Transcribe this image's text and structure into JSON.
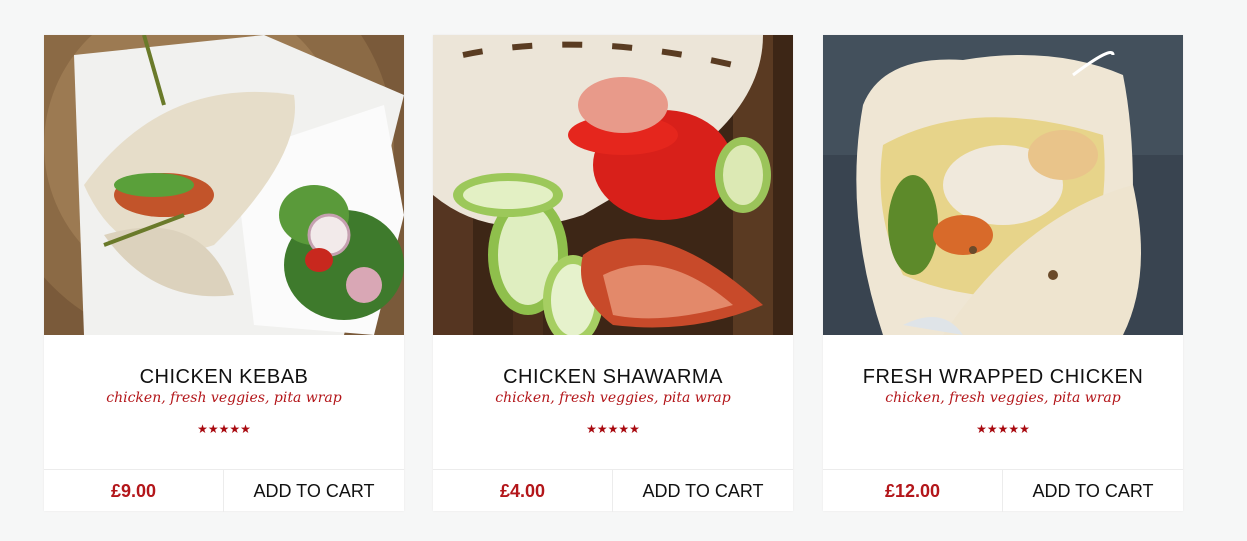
{
  "products": [
    {
      "title": "CHICKEN KEBAB",
      "description": "chicken, fresh veggies, pita wrap",
      "rating": 5,
      "rating_display": "★★★★★",
      "price": "£9.00",
      "cart_label": "ADD TO CART",
      "image_alt": "chicken-kebab-photo"
    },
    {
      "title": "CHICKEN SHAWARMA",
      "description": "chicken, fresh veggies, pita wrap",
      "rating": 5,
      "rating_display": "★★★★★",
      "price": "£4.00",
      "cart_label": "ADD TO CART",
      "image_alt": "chicken-shawarma-photo"
    },
    {
      "title": "FRESH WRAPPED CHICKEN",
      "description": "chicken, fresh veggies, pita wrap",
      "rating": 5,
      "rating_display": "★★★★★",
      "price": "£12.00",
      "cart_label": "ADD TO CART",
      "image_alt": "fresh-wrapped-chicken-photo"
    }
  ],
  "colors": {
    "accent": "#b3161a",
    "star": "#a8090f",
    "background": "#f6f7f7",
    "card": "#ffffff"
  }
}
